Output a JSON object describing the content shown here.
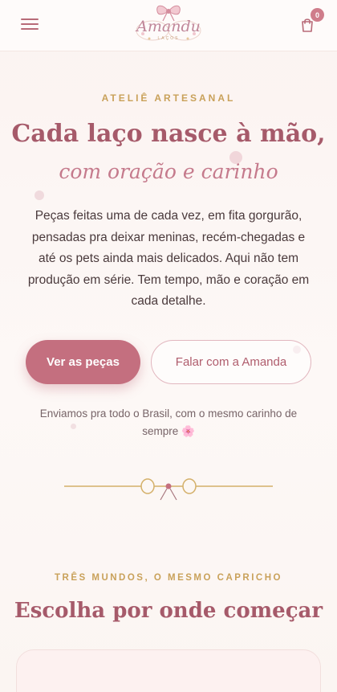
{
  "header": {
    "logo_text": "Amandu",
    "logo_sub": "LAÇOS",
    "cart_count": "0",
    "menu_icon": "hamburger-icon",
    "cart_icon": "shopping-bag-icon"
  },
  "hero": {
    "eyebrow": "ATELIÊ ARTESANAL",
    "headline": "Cada laço nasce à mão,",
    "headline_script": "com oração e carinho",
    "intro": "Peças feitas uma de cada vez, em fita gorgurão, pensadas pra deixar meninas, recém-chegadas e até os pets ainda mais delicados. Aqui não tem produção em série. Tem tempo, mão e coração em cada detalhe.",
    "primary_button": "Ver as peças",
    "secondary_button": "Falar com a Amanda",
    "shipping_note": "Enviamos pra todo o Brasil, com o mesmo carinho de sempre 🌸"
  },
  "section": {
    "eyebrow": "TRÊS MUNDOS, O MESMO CAPRICHO",
    "title": "Escolha por onde começar"
  },
  "colors": {
    "accent_rose": "#c46f7f",
    "gold": "#c9a15a",
    "title_rose": "#a65a6a"
  }
}
